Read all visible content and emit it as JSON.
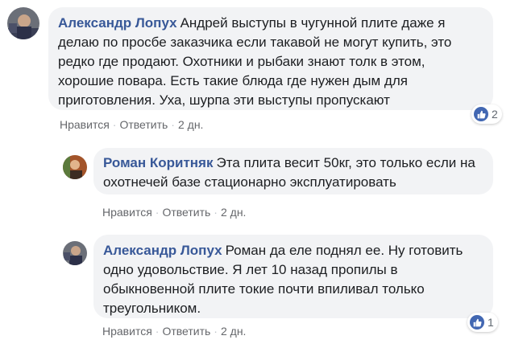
{
  "colors": {
    "author": "#385898",
    "bubble_bg": "#f2f3f5",
    "action_text": "#606770",
    "like_blue": "#4267b2"
  },
  "comments": [
    {
      "author": "Александр Лопух",
      "text": "Андрей выступы в чугунной плите даже я делаю по просбе заказчика если такавой не могут купить, это редко где продают. Охотники и рыбаки знают толк в этом, хорошие повара. Есть такие блюда где нужен дым для приготовления. Уха, шурпа эти выступы пропускают",
      "like_label": "Нравится",
      "reply_label": "Ответить",
      "time": "2 дн.",
      "reactions": "2",
      "reaction_icon": "like-icon"
    },
    {
      "author": "Роман Коритняк",
      "text": "Эта плита весит 50кг, это только если на охотнечей базе стационарно эксплуатировать",
      "like_label": "Нравится",
      "reply_label": "Ответить",
      "time": "2 дн."
    },
    {
      "author": "Александр Лопух",
      "text": "Роман да еле поднял ее. Ну готовить одно удовольствие. Я лет 10 назад пропилы в обыкновенной плите токие почти впиливал только треугольником.",
      "like_label": "Нравится",
      "reply_label": "Ответить",
      "time": "2 дн.",
      "reactions": "1",
      "reaction_icon": "like-icon"
    }
  ]
}
